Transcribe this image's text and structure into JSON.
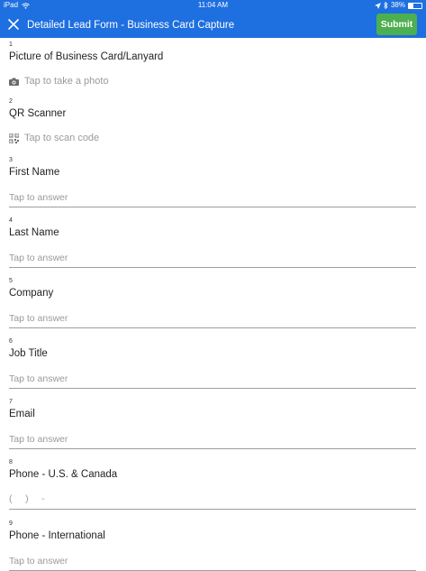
{
  "status_bar": {
    "device": "iPad",
    "time": "11:04 AM",
    "battery": "38%",
    "battery_level": 0.38
  },
  "header": {
    "title": "Detailed Lead Form - Business Card Capture",
    "submit_label": "Submit"
  },
  "questions": [
    {
      "number": "1",
      "label": "Picture of Business Card/Lanyard",
      "action": "Tap to take a photo"
    },
    {
      "number": "2",
      "label": "QR Scanner",
      "action": "Tap to scan code"
    },
    {
      "number": "3",
      "label": "First Name",
      "placeholder": "Tap to answer"
    },
    {
      "number": "4",
      "label": "Last Name",
      "placeholder": "Tap to answer"
    },
    {
      "number": "5",
      "label": "Company",
      "placeholder": "Tap to answer"
    },
    {
      "number": "6",
      "label": "Job Title",
      "placeholder": "Tap to answer"
    },
    {
      "number": "7",
      "label": "Email",
      "placeholder": "Tap to answer"
    },
    {
      "number": "8",
      "label": "Phone - U.S. & Canada",
      "placeholder": "(     )     -"
    },
    {
      "number": "9",
      "label": "Phone - International",
      "placeholder": "Tap to answer"
    }
  ]
}
